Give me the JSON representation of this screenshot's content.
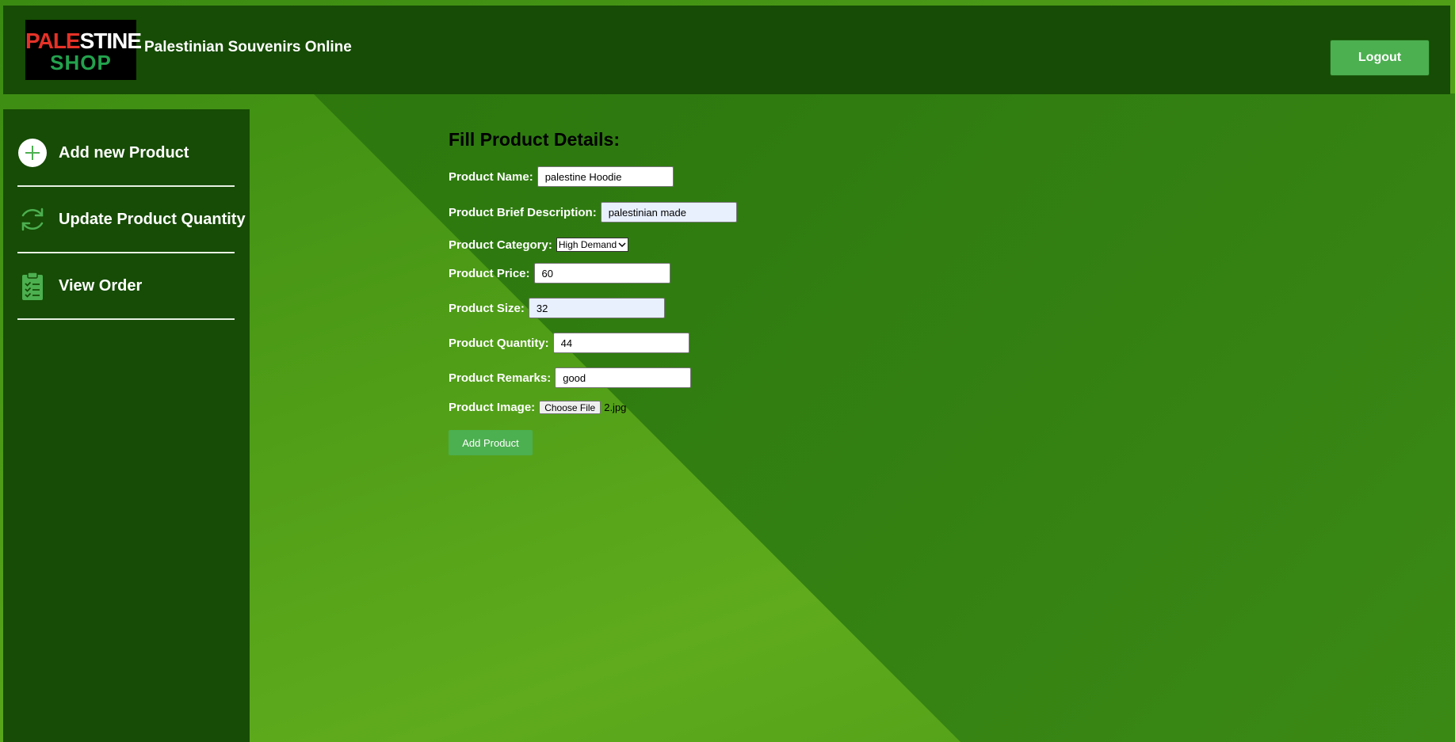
{
  "header": {
    "logo_text_red": "PALE",
    "logo_text_white": "STINE",
    "logo_text_green": "SHOP",
    "title": "Palestinian Souvenirs Online",
    "logout_label": "Logout"
  },
  "sidebar": {
    "items": [
      {
        "label": "Add new Product",
        "icon": "plus-circle-icon"
      },
      {
        "label": "Update Product Quantity",
        "icon": "refresh-icon"
      },
      {
        "label": "View Order",
        "icon": "clipboard-checklist-icon"
      }
    ]
  },
  "form": {
    "title": "Fill Product Details:",
    "name": {
      "label": "Product Name:",
      "value": "palestine Hoodie"
    },
    "description": {
      "label": "Product Brief Description:",
      "value": "palestinian made"
    },
    "category": {
      "label": "Product Category:",
      "selected": "High Demand"
    },
    "price": {
      "label": "Product Price:",
      "value": "60"
    },
    "size": {
      "label": "Product Size:",
      "value": "32"
    },
    "quantity": {
      "label": "Product Quantity:",
      "value": "44"
    },
    "remarks": {
      "label": "Product Remarks:",
      "value": "good"
    },
    "image": {
      "label": "Product Image:",
      "button": "Choose File",
      "file_name": "2.jpg"
    },
    "submit_label": "Add Product"
  },
  "colors": {
    "header_bg": "#164c05",
    "sidebar_bg": "#164c05",
    "accent_button": "#4caf50",
    "logo_red": "#e53228",
    "logo_green": "#23a24d"
  }
}
